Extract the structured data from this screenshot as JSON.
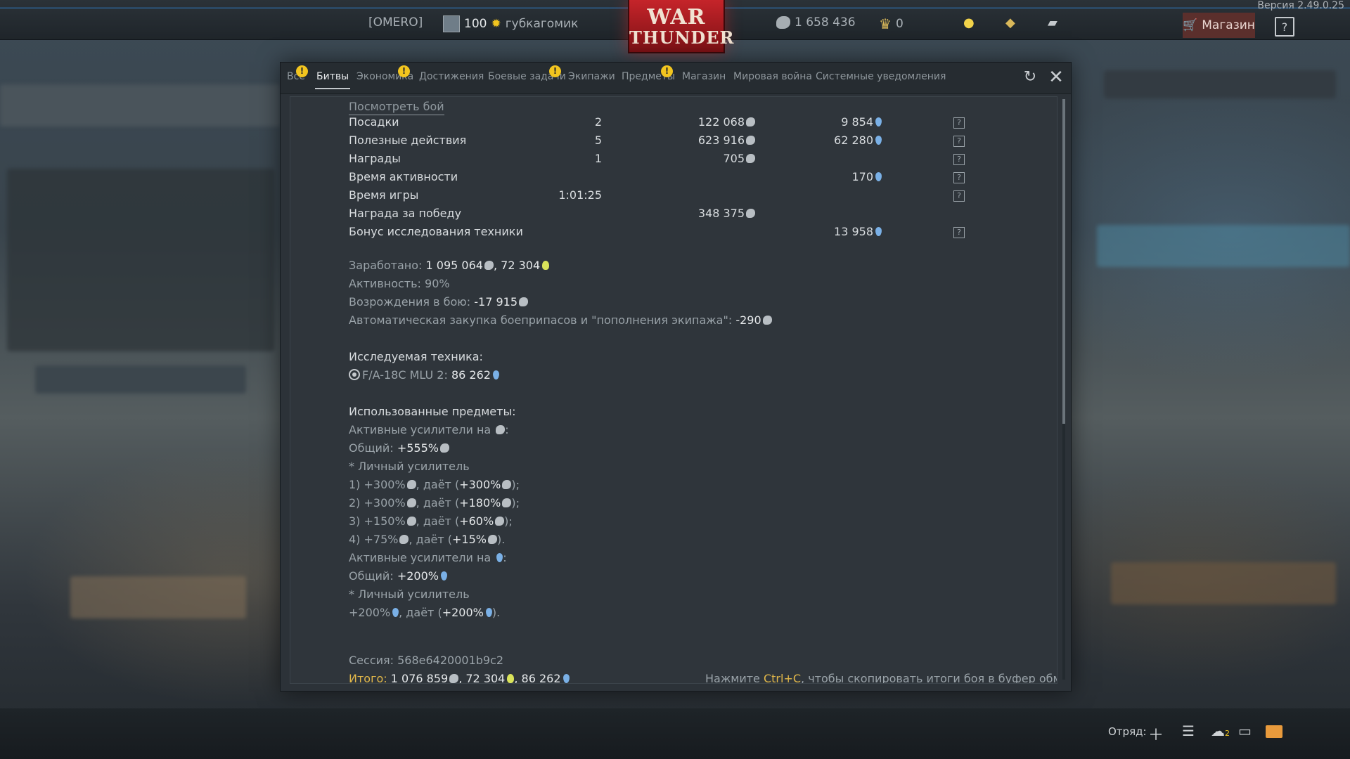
{
  "app": {
    "version": "Версия 2.49.0.25",
    "logo_line1": "WAR",
    "logo_line2": "THUNDER"
  },
  "topbar": {
    "squad_tag": "[OMERO]",
    "level": "100",
    "nickname": "губкагомик",
    "silver_lions": "1 658 436",
    "golden_eagles": "0",
    "shop_label": "Магазин",
    "help_label": "?"
  },
  "tabs": [
    {
      "label": "Все",
      "warning": true
    },
    {
      "label": "Битвы",
      "warning": false,
      "active": true
    },
    {
      "label": "Экономика",
      "warning": true
    },
    {
      "label": "Достижения",
      "warning": false
    },
    {
      "label": "Боевые задачи",
      "warning": true
    },
    {
      "label": "Экипажи",
      "warning": false
    },
    {
      "label": "Предметы",
      "warning": true
    },
    {
      "label": "Магазин",
      "warning": false
    },
    {
      "label": "Мировая война",
      "warning": false
    },
    {
      "label": "Системные уведомления",
      "warning": false
    }
  ],
  "warning_mark": "!",
  "report": {
    "view_battle": "Посмотреть бой",
    "rows": [
      {
        "name": "Посадки",
        "count": "2",
        "sl": "122 068",
        "rp": "9 854",
        "help": true
      },
      {
        "name": "Полезные действия",
        "count": "5",
        "sl": "623 916",
        "rp": "62 280",
        "help": true
      },
      {
        "name": "Награды",
        "count": "1",
        "sl": "705",
        "rp": "",
        "help": true
      },
      {
        "name": "Время активности",
        "count": "",
        "sl": "",
        "rp": "170",
        "help": true
      },
      {
        "name": "Время игры",
        "count": "1:01:25",
        "sl": "",
        "rp": "",
        "help": true
      },
      {
        "name": "Награда за победу",
        "count": "",
        "sl": "348 375",
        "rp": "",
        "help": false
      },
      {
        "name": "Бонус исследования техники",
        "count": "",
        "sl": "",
        "rp": "13 958",
        "help": true
      }
    ],
    "earned_label": "Заработано: ",
    "earned_sl": "1 095 064",
    "earned_rp": "72 304",
    "activity": "Активность: 90%",
    "respawns_label": "Возрождения в бою: ",
    "respawns_value": "-17 915",
    "autobuy_label": "Автоматическая закупка боеприпасов и \"пополнения экипажа\": ",
    "autobuy_value": "-290",
    "research_heading": "Исследуемая техника:",
    "research_vehicle": "F/A-18C MLU 2: ",
    "research_value": "86 262",
    "items_heading": "Использованные предметы:",
    "boost_sl_heading": "Активные усилители на ",
    "total_sl_label": "Общий: ",
    "total_sl_value": "+555%",
    "personal_booster": "* Личный усилитель",
    "sl_boosters": [
      {
        "prefix": "1) +300%",
        "mid": ", даёт (",
        "val": "+300%",
        "end": ");"
      },
      {
        "prefix": "2) +300%",
        "mid": ", даёт (",
        "val": "+180%",
        "end": ");"
      },
      {
        "prefix": "3) +150%",
        "mid": ", даёт (",
        "val": "+60%",
        "end": ");"
      },
      {
        "prefix": "4) +75%",
        "mid": ", даёт (",
        "val": "+15%",
        "end": ")."
      }
    ],
    "boost_rp_heading": "Активные усилители на ",
    "total_rp_label": "Общий: ",
    "total_rp_value": "+200%",
    "personal_booster_rp": "* Личный усилитель",
    "rp_booster": {
      "prefix": "+200%",
      "mid": ", даёт (",
      "val": "+200%",
      "end": ")."
    },
    "session_label": "Сессия: ",
    "session_id": "568e6420001b9c2",
    "total_label": "Итого:",
    "total_sl": "1 076 859",
    "total_ge": "72 304",
    "total_rp": "86 262",
    "hint_pre": "Нажмите ",
    "hint_key": "Ctrl+C",
    "hint_post": ", чтобы скопировать итоги боя в буфер обмена"
  },
  "bottombar": {
    "squad_label": "Отряд:",
    "contacts_count": "2"
  },
  "colors": {
    "accent_gold": "#e2b84a",
    "rp_blue": "#7ab0e6",
    "shop_bg": "#5b2f2c",
    "logo_red": "#c5242a"
  }
}
